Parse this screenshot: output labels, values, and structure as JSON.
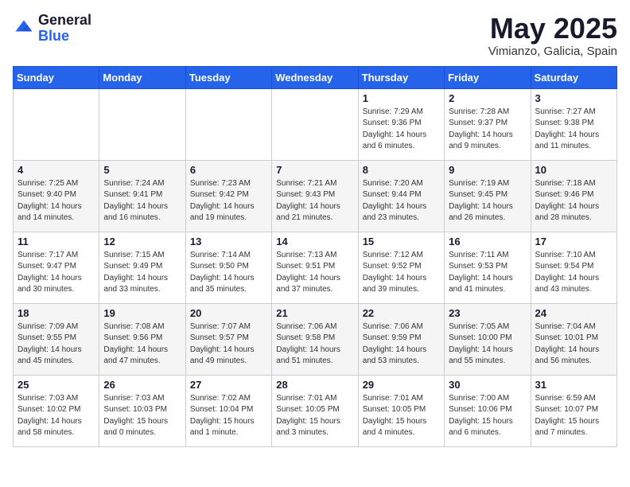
{
  "header": {
    "logo_general": "General",
    "logo_blue": "Blue",
    "month_title": "May 2025",
    "location": "Vimianzo, Galicia, Spain"
  },
  "days_of_week": [
    "Sunday",
    "Monday",
    "Tuesday",
    "Wednesday",
    "Thursday",
    "Friday",
    "Saturday"
  ],
  "weeks": [
    [
      {
        "day": "",
        "info": ""
      },
      {
        "day": "",
        "info": ""
      },
      {
        "day": "",
        "info": ""
      },
      {
        "day": "",
        "info": ""
      },
      {
        "day": "1",
        "info": "Sunrise: 7:29 AM\nSunset: 9:36 PM\nDaylight: 14 hours\nand 6 minutes."
      },
      {
        "day": "2",
        "info": "Sunrise: 7:28 AM\nSunset: 9:37 PM\nDaylight: 14 hours\nand 9 minutes."
      },
      {
        "day": "3",
        "info": "Sunrise: 7:27 AM\nSunset: 9:38 PM\nDaylight: 14 hours\nand 11 minutes."
      }
    ],
    [
      {
        "day": "4",
        "info": "Sunrise: 7:25 AM\nSunset: 9:40 PM\nDaylight: 14 hours\nand 14 minutes."
      },
      {
        "day": "5",
        "info": "Sunrise: 7:24 AM\nSunset: 9:41 PM\nDaylight: 14 hours\nand 16 minutes."
      },
      {
        "day": "6",
        "info": "Sunrise: 7:23 AM\nSunset: 9:42 PM\nDaylight: 14 hours\nand 19 minutes."
      },
      {
        "day": "7",
        "info": "Sunrise: 7:21 AM\nSunset: 9:43 PM\nDaylight: 14 hours\nand 21 minutes."
      },
      {
        "day": "8",
        "info": "Sunrise: 7:20 AM\nSunset: 9:44 PM\nDaylight: 14 hours\nand 23 minutes."
      },
      {
        "day": "9",
        "info": "Sunrise: 7:19 AM\nSunset: 9:45 PM\nDaylight: 14 hours\nand 26 minutes."
      },
      {
        "day": "10",
        "info": "Sunrise: 7:18 AM\nSunset: 9:46 PM\nDaylight: 14 hours\nand 28 minutes."
      }
    ],
    [
      {
        "day": "11",
        "info": "Sunrise: 7:17 AM\nSunset: 9:47 PM\nDaylight: 14 hours\nand 30 minutes."
      },
      {
        "day": "12",
        "info": "Sunrise: 7:15 AM\nSunset: 9:49 PM\nDaylight: 14 hours\nand 33 minutes."
      },
      {
        "day": "13",
        "info": "Sunrise: 7:14 AM\nSunset: 9:50 PM\nDaylight: 14 hours\nand 35 minutes."
      },
      {
        "day": "14",
        "info": "Sunrise: 7:13 AM\nSunset: 9:51 PM\nDaylight: 14 hours\nand 37 minutes."
      },
      {
        "day": "15",
        "info": "Sunrise: 7:12 AM\nSunset: 9:52 PM\nDaylight: 14 hours\nand 39 minutes."
      },
      {
        "day": "16",
        "info": "Sunrise: 7:11 AM\nSunset: 9:53 PM\nDaylight: 14 hours\nand 41 minutes."
      },
      {
        "day": "17",
        "info": "Sunrise: 7:10 AM\nSunset: 9:54 PM\nDaylight: 14 hours\nand 43 minutes."
      }
    ],
    [
      {
        "day": "18",
        "info": "Sunrise: 7:09 AM\nSunset: 9:55 PM\nDaylight: 14 hours\nand 45 minutes."
      },
      {
        "day": "19",
        "info": "Sunrise: 7:08 AM\nSunset: 9:56 PM\nDaylight: 14 hours\nand 47 minutes."
      },
      {
        "day": "20",
        "info": "Sunrise: 7:07 AM\nSunset: 9:57 PM\nDaylight: 14 hours\nand 49 minutes."
      },
      {
        "day": "21",
        "info": "Sunrise: 7:06 AM\nSunset: 9:58 PM\nDaylight: 14 hours\nand 51 minutes."
      },
      {
        "day": "22",
        "info": "Sunrise: 7:06 AM\nSunset: 9:59 PM\nDaylight: 14 hours\nand 53 minutes."
      },
      {
        "day": "23",
        "info": "Sunrise: 7:05 AM\nSunset: 10:00 PM\nDaylight: 14 hours\nand 55 minutes."
      },
      {
        "day": "24",
        "info": "Sunrise: 7:04 AM\nSunset: 10:01 PM\nDaylight: 14 hours\nand 56 minutes."
      }
    ],
    [
      {
        "day": "25",
        "info": "Sunrise: 7:03 AM\nSunset: 10:02 PM\nDaylight: 14 hours\nand 58 minutes."
      },
      {
        "day": "26",
        "info": "Sunrise: 7:03 AM\nSunset: 10:03 PM\nDaylight: 15 hours\nand 0 minutes."
      },
      {
        "day": "27",
        "info": "Sunrise: 7:02 AM\nSunset: 10:04 PM\nDaylight: 15 hours\nand 1 minute."
      },
      {
        "day": "28",
        "info": "Sunrise: 7:01 AM\nSunset: 10:05 PM\nDaylight: 15 hours\nand 3 minutes."
      },
      {
        "day": "29",
        "info": "Sunrise: 7:01 AM\nSunset: 10:05 PM\nDaylight: 15 hours\nand 4 minutes."
      },
      {
        "day": "30",
        "info": "Sunrise: 7:00 AM\nSunset: 10:06 PM\nDaylight: 15 hours\nand 6 minutes."
      },
      {
        "day": "31",
        "info": "Sunrise: 6:59 AM\nSunset: 10:07 PM\nDaylight: 15 hours\nand 7 minutes."
      }
    ]
  ]
}
